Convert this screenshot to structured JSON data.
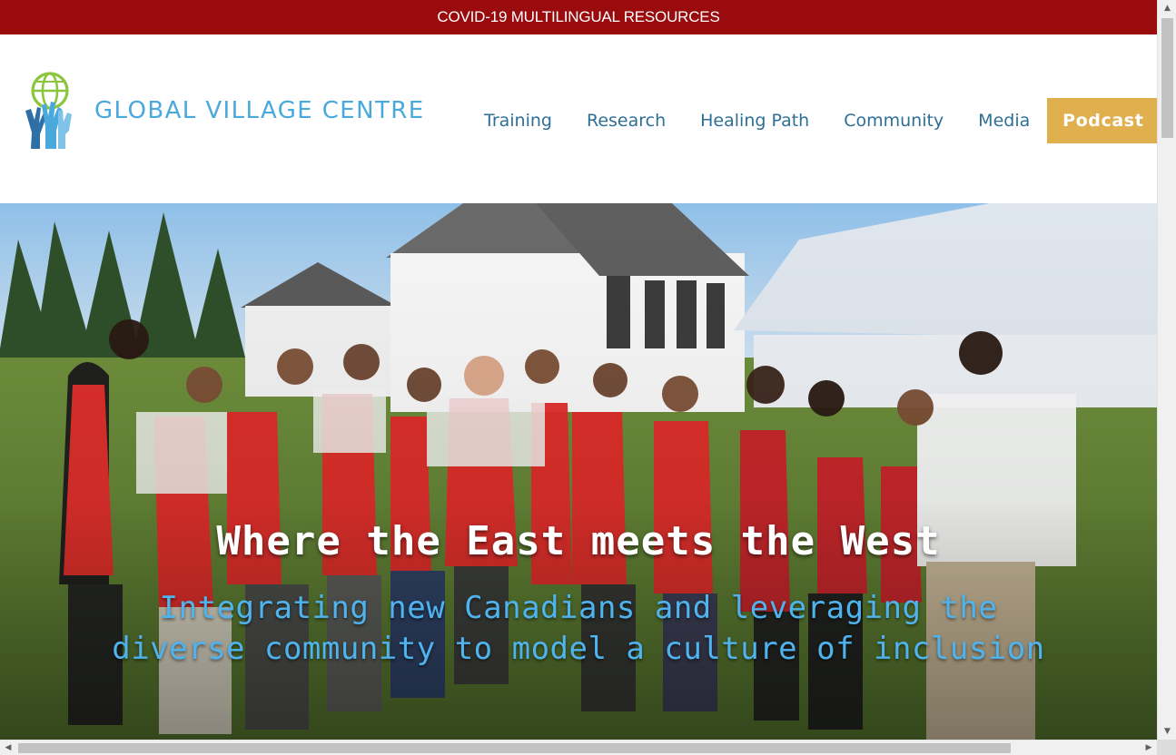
{
  "banner": {
    "link_text": "COVID-19 MULTILINGUAL RESOURCES"
  },
  "header": {
    "logo_text": "GLOBAL VILLAGE CENTRE",
    "logo_icon": "globe-hands-icon",
    "nav": [
      {
        "label": "Training"
      },
      {
        "label": "Research"
      },
      {
        "label": "Healing Path"
      },
      {
        "label": "Community"
      },
      {
        "label": "Media"
      }
    ],
    "cta_label": "Podcast"
  },
  "hero": {
    "title": "Where the East meets the West",
    "subtitle": "Integrating new Canadians and leveraging the diverse community to model a culture of inclusion",
    "image_alt": "group-photo"
  },
  "colors": {
    "banner_bg": "#990b0c",
    "logo_blue": "#4aa9dc",
    "nav_text": "#2f6f96",
    "cta_bg": "#e0b04f",
    "hero_subtitle": "#4fb3ee"
  }
}
